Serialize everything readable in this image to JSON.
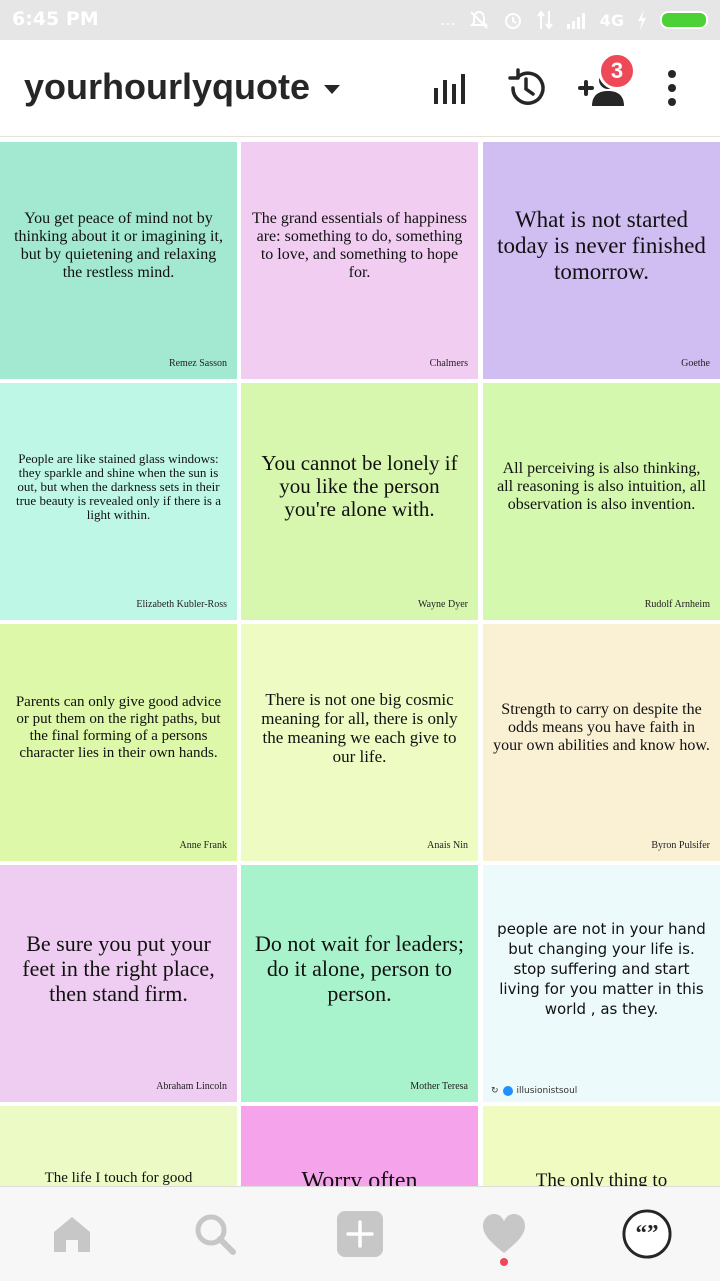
{
  "status_bar": {
    "time": "6:45 PM",
    "network": "4G",
    "battery_color": "#4cd137",
    "icons": [
      "dots-icon",
      "mute-icon",
      "alarm-icon",
      "data-arrows-icon",
      "signal-icon",
      "network-label",
      "charging-icon",
      "battery-icon"
    ]
  },
  "header": {
    "account_name": "yourhourlyquote",
    "notification_count": "3",
    "icons": [
      "insights-icon",
      "archive-history-icon",
      "add-person-icon",
      "more-options-icon"
    ]
  },
  "posts": [
    {
      "quote": "You get peace of mind not by thinking about it or imagining it, but by quietening and relaxing the restless mind.",
      "author": "Remez Sasson",
      "bg": "#a3e9d2"
    },
    {
      "quote": "The grand essentials of happiness are: something to do, something to love, and something to hope for.",
      "author": "Chalmers",
      "bg": "#f1cdf2"
    },
    {
      "quote": "What is not started today is never finished tomorrow.",
      "author": "Goethe",
      "bg": "#d0bdf2"
    },
    {
      "quote": "People are like stained glass windows: they sparkle and shine when the sun is out, but when the darkness sets in their true beauty is revealed only if there is a light within.",
      "author": "Elizabeth Kubler-Ross",
      "bg": "#bff7e6"
    },
    {
      "quote": "You cannot be lonely if you like the person you're alone with.",
      "author": "Wayne Dyer",
      "bg": "#d7f7ae"
    },
    {
      "quote": "All perceiving is also thinking, all reasoning is also intuition, all observation is also invention.",
      "author": "Rudolf Arnheim",
      "bg": "#d3f8ae"
    },
    {
      "quote": "Parents can only give good advice or put them on the right paths, but the final forming of a persons character lies in their own hands.",
      "author": "Anne Frank",
      "bg": "#dcf8a8"
    },
    {
      "quote": "There is not one big cosmic meaning for all, there is only the meaning we each give to our life.",
      "author": "Anais Nin",
      "bg": "#eefbc2"
    },
    {
      "quote": "Strength to carry on despite the odds means you have faith in your own abilities and know how.",
      "author": "Byron Pulsifer",
      "bg": "#faf0d4"
    },
    {
      "quote": "Be sure you put your feet in the right place, then stand firm.",
      "author": "Abraham Lincoln",
      "bg": "#efcdf2"
    },
    {
      "quote": "Do not wait for leaders; do it alone, person to person.",
      "author": "Mother Teresa",
      "bg": "#a8f2cc"
    },
    {
      "quote": "people are not in your hand but changing your life is. stop suffering and start living for you matter in this world , as they.",
      "author": "illusionistsoul",
      "bg": "#edfafb"
    },
    {
      "quote": "The life I touch for good",
      "author": "",
      "bg": "#ecfbc6"
    },
    {
      "quote": "Worry often",
      "author": "",
      "bg": "#f5a3ea"
    },
    {
      "quote": "The only thing to",
      "author": "",
      "bg": "#effbc0"
    }
  ],
  "bottom_nav": {
    "items": [
      "home-icon",
      "search-icon",
      "new-post-icon",
      "activity-heart-icon",
      "profile-quote-icon"
    ],
    "active_color": "#262626",
    "inactive_color": "#c7c7c7"
  }
}
